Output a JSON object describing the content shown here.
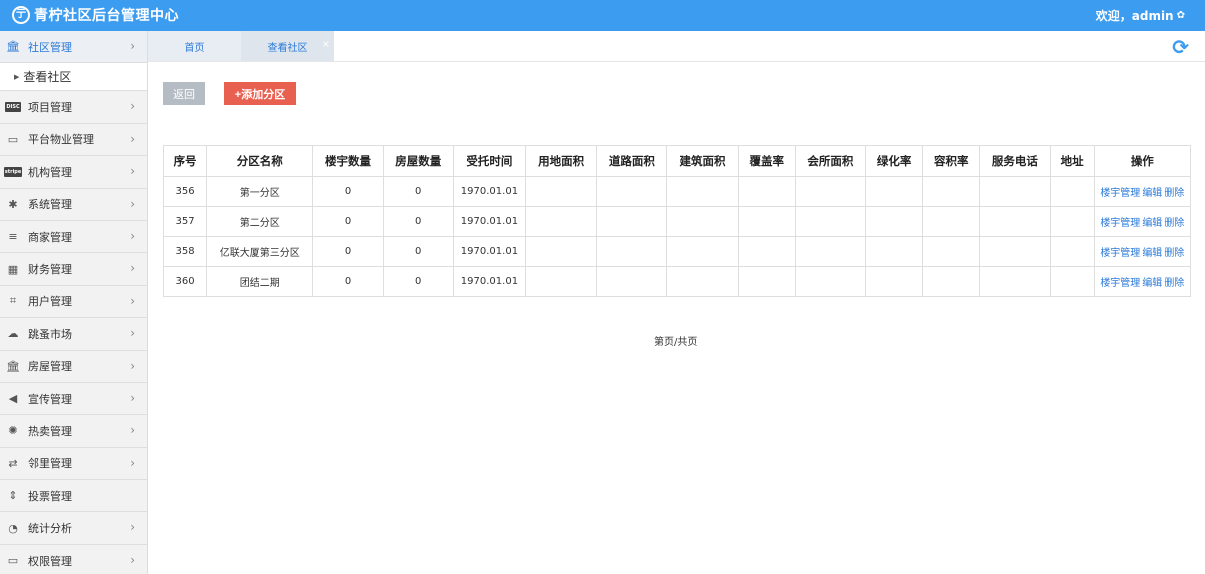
{
  "header": {
    "brand_icon": "亍",
    "title": "青柠社区后台管理中心",
    "welcome": "欢迎，admin"
  },
  "sidebar": {
    "items": [
      {
        "label": "社区管理",
        "icon": "bank-icon",
        "active": true
      },
      {
        "label": "项目管理",
        "icon": "discover-icon"
      },
      {
        "label": "平台物业管理",
        "icon": "desktop-icon"
      },
      {
        "label": "机构管理",
        "icon": "stripe-icon"
      },
      {
        "label": "系统管理",
        "icon": "yelp-icon"
      },
      {
        "label": "商家管理",
        "icon": "bars-icon"
      },
      {
        "label": "财务管理",
        "icon": "calculator-icon"
      },
      {
        "label": "用户管理",
        "icon": "crop-icon"
      },
      {
        "label": "跳蚤市场",
        "icon": "cloud-icon"
      },
      {
        "label": "房屋管理",
        "icon": "bank-icon"
      },
      {
        "label": "宣传管理",
        "icon": "volume-icon"
      },
      {
        "label": "热卖管理",
        "icon": "sun-icon"
      },
      {
        "label": "邻里管理",
        "icon": "retweet-icon"
      },
      {
        "label": "投票管理",
        "icon": "sort-icon"
      },
      {
        "label": "统计分析",
        "icon": "pie-chart-icon"
      },
      {
        "label": "权限管理",
        "icon": "desktop-icon"
      }
    ],
    "sub_item": "查看社区"
  },
  "tabs": [
    {
      "label": "首页"
    },
    {
      "label": "查看社区",
      "close": "×"
    }
  ],
  "actions": {
    "back": "返回",
    "add": "+添加分区"
  },
  "table": {
    "headers": [
      "序号",
      "分区名称",
      "楼宇数量",
      "房屋数量",
      "受托时间",
      "用地面积",
      "道路面积",
      "建筑面积",
      "覆盖率",
      "会所面积",
      "绿化率",
      "容积率",
      "服务电话",
      "地址",
      "操作"
    ],
    "rows": [
      [
        "356",
        "第一分区",
        "0",
        "0",
        "1970.01.01"
      ],
      [
        "357",
        "第二分区",
        "0",
        "0",
        "1970.01.01"
      ],
      [
        "358",
        "亿联大厦第三分区",
        "0",
        "0",
        "1970.01.01"
      ],
      [
        "360",
        "团结二期",
        "0",
        "0",
        "1970.01.01"
      ]
    ],
    "ops": [
      "楼宇管理",
      "编辑",
      "删除"
    ]
  },
  "pager": "第页/共页",
  "colors": {
    "primary": "#3c9df0",
    "link": "#2a7ad8",
    "danger": "#e86150",
    "muted": "#b5bcc4"
  }
}
